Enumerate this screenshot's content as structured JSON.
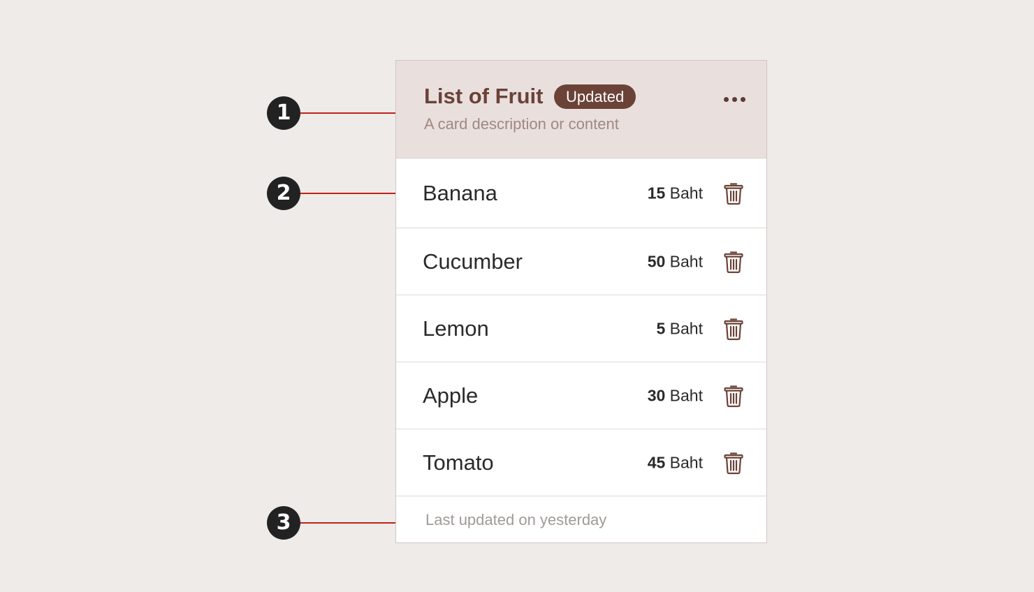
{
  "callouts": [
    "1",
    "2",
    "3"
  ],
  "card": {
    "title": "List of Fruit",
    "badge": "Updated",
    "description": "A card description or content",
    "more_icon": "more-horizontal-icon",
    "items": [
      {
        "name": "Banana",
        "price": "15",
        "unit": "Baht"
      },
      {
        "name": "Cucumber",
        "price": "50",
        "unit": "Baht"
      },
      {
        "name": "Lemon",
        "price": "5",
        "unit": "Baht"
      },
      {
        "name": "Apple",
        "price": "30",
        "unit": "Baht"
      },
      {
        "name": "Tomato",
        "price": "45",
        "unit": "Baht"
      }
    ],
    "delete_icon": "trash-icon",
    "footer": "Last updated on yesterday"
  },
  "colors": {
    "background": "#efebe8",
    "header_background": "#e9e0de",
    "brand_brown": "#6b4237",
    "callout_marker": "#222222",
    "callout_line": "#c0221b"
  }
}
